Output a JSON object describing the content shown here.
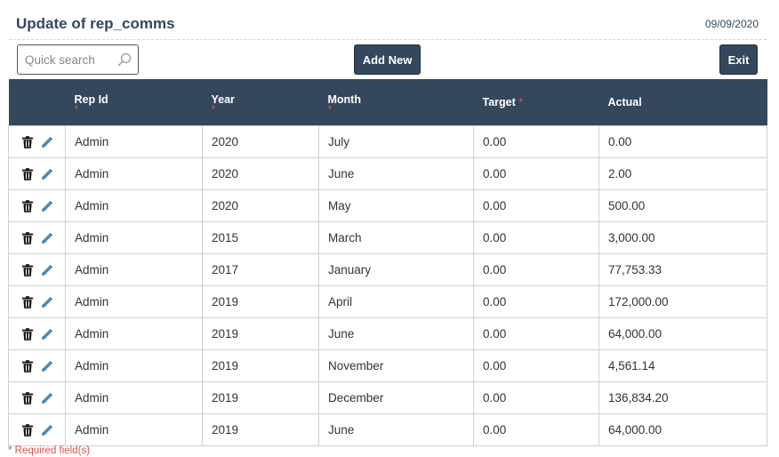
{
  "header": {
    "title": "Update of rep_comms",
    "date": "09/09/2020"
  },
  "toolbar": {
    "search_placeholder": "Quick search",
    "search_value": "",
    "add_label": "Add New",
    "exit_label": "Exit"
  },
  "table": {
    "columns": [
      {
        "label": "Rep Id",
        "required": true
      },
      {
        "label": "Year",
        "required": true
      },
      {
        "label": "Month",
        "required": true
      },
      {
        "label": "Target",
        "required": true
      },
      {
        "label": "Actual",
        "required": false
      }
    ],
    "required_mark": "*",
    "rows": [
      [
        "Admin",
        "2020",
        "July",
        "0.00",
        "0.00"
      ],
      [
        "Admin",
        "2020",
        "June",
        "0.00",
        "2.00"
      ],
      [
        "Admin",
        "2020",
        "May",
        "0.00",
        "500.00"
      ],
      [
        "Admin",
        "2015",
        "March",
        "0.00",
        "3,000.00"
      ],
      [
        "Admin",
        "2017",
        "January",
        "0.00",
        "77,753.33"
      ],
      [
        "Admin",
        "2019",
        "April",
        "0.00",
        "172,000.00"
      ],
      [
        "Admin",
        "2019",
        "June",
        "0.00",
        "64,000.00"
      ],
      [
        "Admin",
        "2019",
        "November",
        "0.00",
        "4,561.14"
      ],
      [
        "Admin",
        "2019",
        "December",
        "0.00",
        "136,834.20"
      ],
      [
        "Admin",
        "2019",
        "June",
        "0.00",
        "64,000.00"
      ]
    ]
  },
  "footer": {
    "required_note": "* Required field(s)"
  },
  "icons": {
    "delete": "trash-icon",
    "edit": "pencil-icon",
    "search": "search-icon"
  },
  "colors": {
    "header_bg": "#34475d",
    "required": "#e05555",
    "edit_icon": "#4a8fb5"
  }
}
